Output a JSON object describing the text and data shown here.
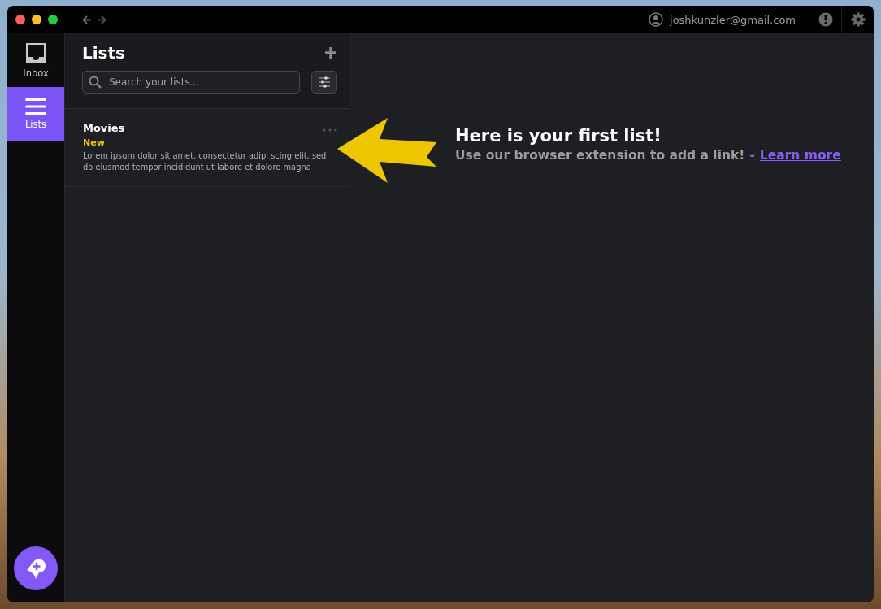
{
  "account": {
    "email": "joshkunzler@gmail.com"
  },
  "nav": [
    {
      "kind": "inbox",
      "label": "Inbox",
      "selected": false
    },
    {
      "kind": "lists",
      "label": "Lists",
      "selected": true
    }
  ],
  "lists_panel": {
    "title": "Lists",
    "search": {
      "placeholder": "Search your lists..."
    },
    "items": [
      {
        "name": "Movies",
        "badge": "New",
        "description": "Lorem ipsum dolor sit amet, consectetur adipi scing elit, sed do eiusmod tempor incididunt ut labore et dolore magna"
      }
    ]
  },
  "hint": {
    "title": "Here is your first list!",
    "text": "Use our browser extension to add a link!",
    "link_prefix": "-",
    "link": "Learn more"
  }
}
